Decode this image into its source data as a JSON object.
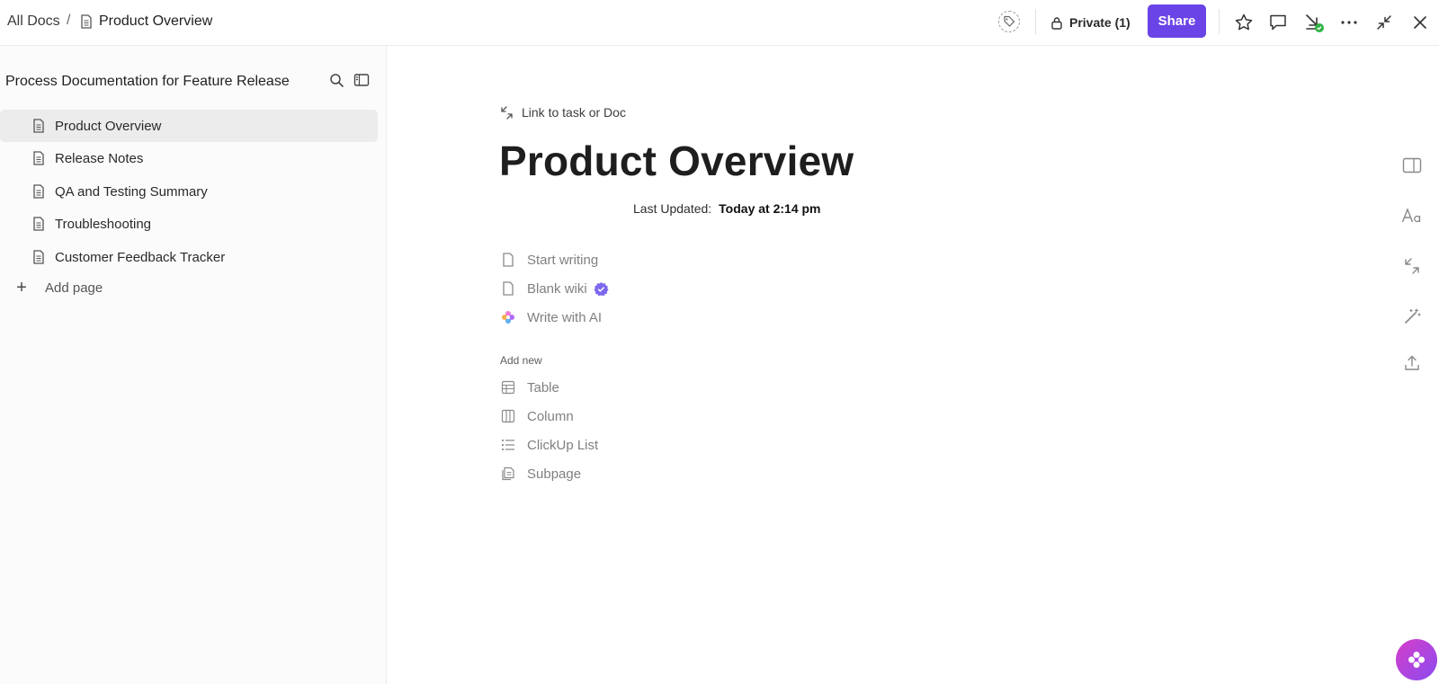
{
  "breadcrumb": {
    "root": "All Docs",
    "separator": "/",
    "current": "Product Overview"
  },
  "header": {
    "private_label": "Private (1)",
    "share_label": "Share"
  },
  "sidebar": {
    "title": "Process Documentation for Feature Release",
    "items": [
      {
        "label": "Product Overview",
        "active": true
      },
      {
        "label": "Release Notes",
        "active": false
      },
      {
        "label": "QA and Testing Summary",
        "active": false
      },
      {
        "label": "Troubleshooting",
        "active": false
      },
      {
        "label": "Customer Feedback Tracker",
        "active": false
      }
    ],
    "add_page_label": "Add page"
  },
  "doc": {
    "link_label": "Link to task or Doc",
    "title": "Product Overview",
    "updated_label": "Last Updated:",
    "updated_value": "Today at 2:14 pm",
    "start_options": [
      {
        "label": "Start writing",
        "icon": "doc-icon"
      },
      {
        "label": "Blank wiki",
        "icon": "doc-icon"
      },
      {
        "label": "Write with AI",
        "icon": "ai-sparkle-icon"
      }
    ],
    "add_new_label": "Add new",
    "add_new_items": [
      {
        "label": "Table",
        "icon": "table-icon"
      },
      {
        "label": "Column",
        "icon": "columns-icon"
      },
      {
        "label": "ClickUp List",
        "icon": "list-icon"
      },
      {
        "label": "Subpage",
        "icon": "subpage-icon"
      }
    ]
  },
  "colors": {
    "accent": "#6a44e6",
    "success": "#2fb344",
    "verified": "#7b68ee"
  }
}
